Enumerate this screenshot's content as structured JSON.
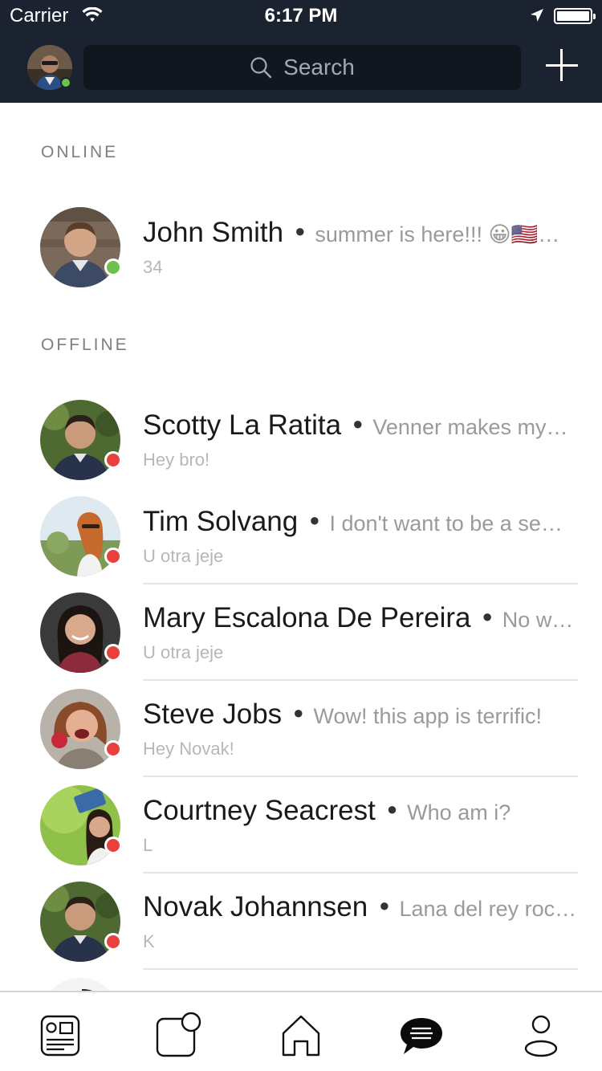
{
  "status_bar": {
    "carrier": "Carrier",
    "time": "6:17 PM"
  },
  "header": {
    "search": {
      "placeholder": "Search"
    },
    "self_status": "online"
  },
  "sections": {
    "online": "ONLINE",
    "offline": "OFFLINE"
  },
  "contacts": [
    {
      "name": "John Smith",
      "message": "summer is here!!! 😀🇺🇸…",
      "sub": "34",
      "status": "online"
    },
    {
      "name": "Scotty La Ratita",
      "message": "Venner makes my…",
      "sub": "Hey bro!",
      "status": "offline"
    },
    {
      "name": "Tim Solvang",
      "message": "I don't want to be a se…",
      "sub": "U otra jeje",
      "status": "offline"
    },
    {
      "name": "Mary Escalona De Pereira",
      "message": "No w…",
      "sub": "U otra jeje",
      "status": "offline"
    },
    {
      "name": "Steve Jobs",
      "message": "Wow! this app is terrific!",
      "sub": "Hey Novak!",
      "status": "offline"
    },
    {
      "name": "Courtney Seacrest",
      "message": "Who am i?",
      "sub": "L",
      "status": "offline"
    },
    {
      "name": "Novak Johannsen",
      "message": "Lana del rey roc…",
      "sub": "K",
      "status": "offline"
    }
  ],
  "tabs": [
    {
      "icon": "feed-icon"
    },
    {
      "icon": "notifications-icon"
    },
    {
      "icon": "home-icon"
    },
    {
      "icon": "chat-icon",
      "active": true
    },
    {
      "icon": "profile-icon"
    }
  ],
  "colors": {
    "header_bg": "#1c2330",
    "online": "#6cc24a",
    "offline": "#e8403b"
  }
}
